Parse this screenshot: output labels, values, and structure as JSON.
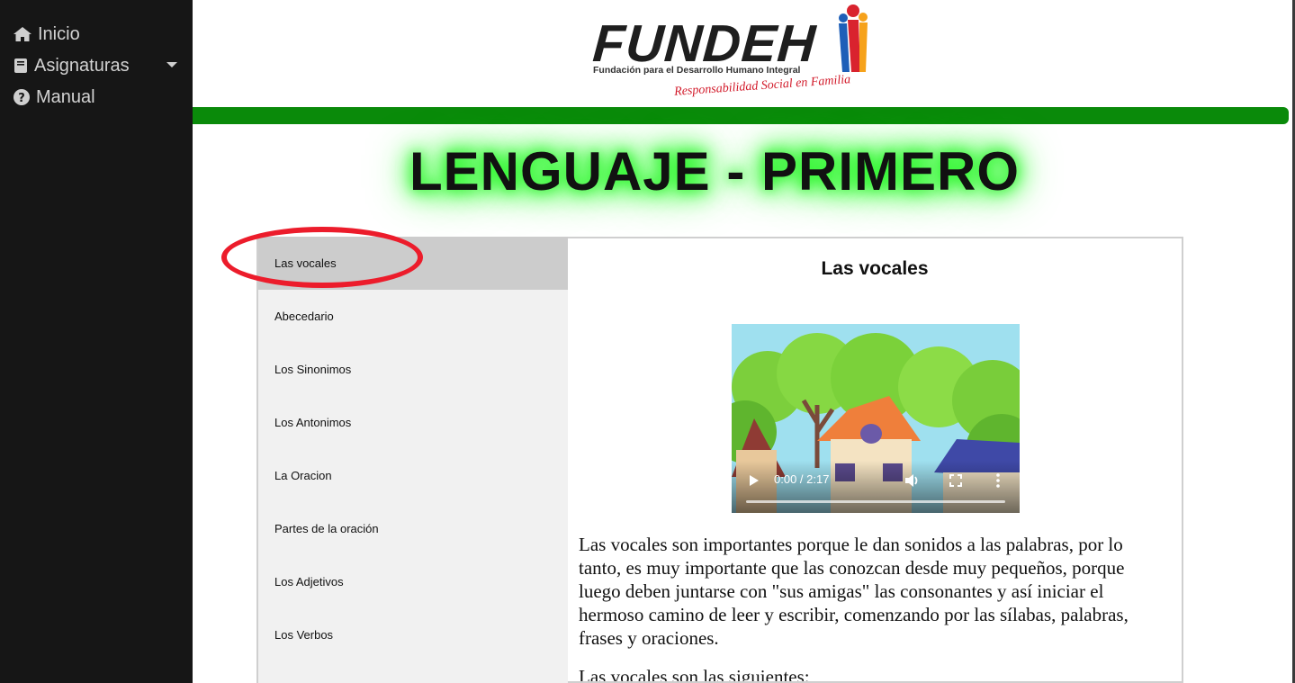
{
  "sidebar": {
    "items": [
      {
        "label": "Inicio",
        "icon": "home-icon"
      },
      {
        "label": "Asignaturas",
        "icon": "book-icon"
      },
      {
        "label": "Manual",
        "icon": "question-circle-icon"
      }
    ]
  },
  "header": {
    "logo_text": "FUNDEH",
    "logo_subtitle": "Fundación para el Desarrollo Humano Integral",
    "logo_tagline": "Responsabilidad Social en Familia",
    "accent_color": "#0a8a0a"
  },
  "page_title": "LENGUAJE - PRIMERO",
  "topics": [
    {
      "label": "Las vocales",
      "active": true
    },
    {
      "label": "Abecedario"
    },
    {
      "label": "Los Sinonimos"
    },
    {
      "label": "Los Antonimos"
    },
    {
      "label": "La Oracion"
    },
    {
      "label": "Partes de la oración"
    },
    {
      "label": "Los Adjetivos"
    },
    {
      "label": "Los Verbos"
    }
  ],
  "content": {
    "title": "Las vocales",
    "video": {
      "time": "0:00 / 2:17",
      "progress": 0
    },
    "paragraph1": "Las vocales son importantes porque le dan sonidos a las palabras, por lo tanto, es muy importante que las conozcan desde muy pequeños, porque luego deben juntarse con \"sus amigas\" las consonantes y así iniciar el hermoso camino de leer y escribir, comenzando por las sílabas, palabras, frases y oraciones.",
    "paragraph2": "Las vocales son las siguientes:"
  },
  "annotation_color": "#ec1c2b"
}
